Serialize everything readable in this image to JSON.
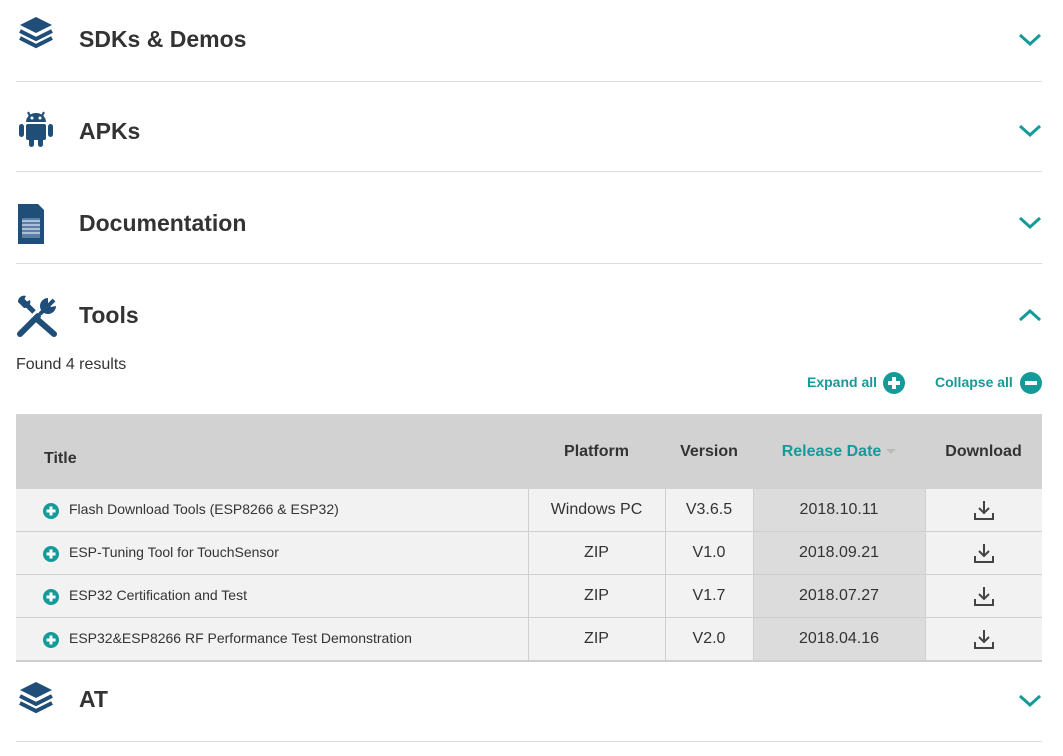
{
  "sections": {
    "sdks": {
      "title": "SDKs & Demos",
      "icon": "layers-icon"
    },
    "apks": {
      "title": "APKs",
      "icon": "android-icon"
    },
    "documentation": {
      "title": "Documentation",
      "icon": "document-icon"
    },
    "tools": {
      "title": "Tools",
      "icon": "tools-icon"
    },
    "at": {
      "title": "AT",
      "icon": "layers-icon"
    }
  },
  "tools": {
    "found_text": "Found 4 results",
    "expand_all": "Expand all",
    "collapse_all": "Collapse all",
    "columns": {
      "title": "Title",
      "platform": "Platform",
      "version": "Version",
      "release_date": "Release Date",
      "download": "Download"
    },
    "rows": [
      {
        "title": "Flash Download Tools (ESP8266 & ESP32)",
        "platform": "Windows PC",
        "version": "V3.6.5",
        "date": "2018.10.11"
      },
      {
        "title": "ESP-Tuning Tool for TouchSensor",
        "platform": "ZIP",
        "version": "V1.0",
        "date": "2018.09.21"
      },
      {
        "title": "ESP32 Certification and Test",
        "platform": "ZIP",
        "version": "V1.7",
        "date": "2018.07.27"
      },
      {
        "title": "ESP32&ESP8266 RF Performance Test Demonstration",
        "platform": "ZIP",
        "version": "V2.0",
        "date": "2018.04.16"
      }
    ]
  },
  "colors": {
    "accent": "#149b99",
    "icon_navy": "#1f4e79",
    "header_bg": "#d2d2d2"
  }
}
